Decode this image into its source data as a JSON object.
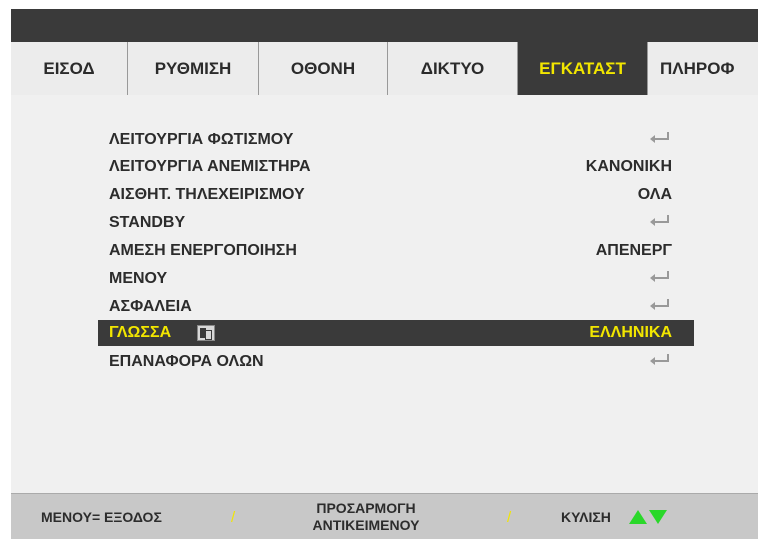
{
  "tabs": [
    {
      "label": "ΕΙΣΟΔ",
      "active": false
    },
    {
      "label": "ΡΥΘΜΙΣΗ",
      "active": false
    },
    {
      "label": "ΟΘΟΝΗ",
      "active": false
    },
    {
      "label": "ΔΙΚΤΥΟ",
      "active": false
    },
    {
      "label": "ΕΓΚΑΤΑΣΤ",
      "active": true
    },
    {
      "label": "ΠΛΗΡΟΦ",
      "active": false
    }
  ],
  "menu": {
    "items": [
      {
        "label": "ΛΕΙΤΟΥΡΓΙΑ ΦΩΤΙΣΜΟΥ",
        "value": "",
        "icon": "enter-icon"
      },
      {
        "label": "ΛΕΙΤΟΥΡΓΙΑ ΑΝΕΜΙΣΤΗΡΑ",
        "value": "ΚΑΝΟΝΙΚΗ"
      },
      {
        "label": "ΑΙΣΘΗΤ. ΤΗΛΕΧΕΙΡΙΣΜΟΥ",
        "value": "ΟΛΑ"
      },
      {
        "label": "STANDBY",
        "value": "",
        "icon": "enter-icon"
      },
      {
        "label": "ΑΜΕΣΗ ΕΝΕΡΓΟΠΟΙΗΣΗ",
        "value": "ΑΠΕΝΕΡΓ"
      },
      {
        "label": "ΜΕΝΟΥ",
        "value": "",
        "icon": "enter-icon"
      },
      {
        "label": "ΑΣΦΑΛΕΙΑ",
        "value": "",
        "icon": "enter-icon"
      },
      {
        "label": "ΓΛΩΣΣΑ",
        "value": "ΕΛΛΗΝΙΚΑ",
        "selected": true,
        "icon": "language-icon"
      },
      {
        "label": "ΕΠΑΝΑΦΟΡΑ ΟΛΩΝ",
        "value": "",
        "icon": "enter-icon"
      }
    ]
  },
  "footer": {
    "exit_label": "ΜΕΝΟΥ= ΕΞΟΔΟΣ",
    "separator": "/",
    "adjust_line1": "ΠΡΟΣΑΡΜΟΓΗ",
    "adjust_line2": "ΑΝΤΙΚΕΙΜΕΝΟΥ",
    "scroll_label": "ΚΥΛΙΣΗ"
  },
  "colors": {
    "highlight_text": "#f2e600",
    "highlight_bg": "#3a3a3a",
    "arrow_green": "#2ad82a"
  }
}
